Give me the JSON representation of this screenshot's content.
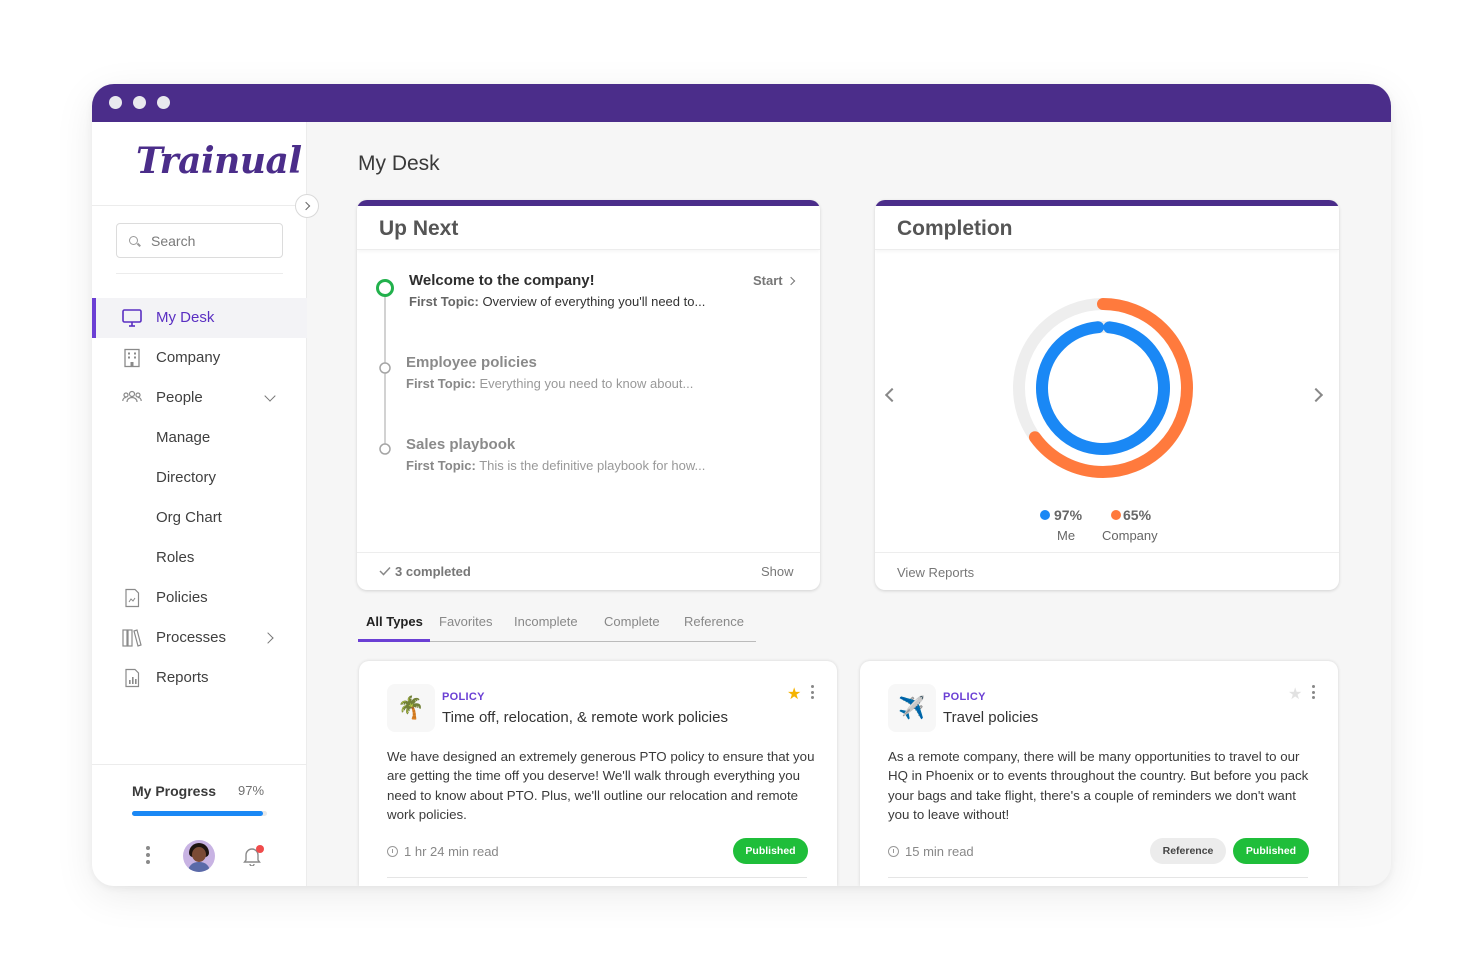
{
  "app": {
    "logo_text": "Trainual",
    "brand_color": "#4b2d8a",
    "accent_color": "#6b3fd4"
  },
  "sidebar": {
    "search_placeholder": "Search",
    "items": [
      {
        "label": "My Desk",
        "icon": "monitor-icon",
        "active": true
      },
      {
        "label": "Company",
        "icon": "building-icon"
      },
      {
        "label": "People",
        "icon": "people-icon",
        "expanded": true
      },
      {
        "label": "Manage"
      },
      {
        "label": "Directory"
      },
      {
        "label": "Org Chart"
      },
      {
        "label": "Roles"
      },
      {
        "label": "Policies",
        "icon": "document-icon"
      },
      {
        "label": "Processes",
        "icon": "books-icon"
      },
      {
        "label": "Reports",
        "icon": "report-icon"
      }
    ],
    "progress": {
      "label": "My Progress",
      "value_text": "97%",
      "value": 0.97
    }
  },
  "main": {
    "page_title": "My Desk",
    "up_next": {
      "title": "Up Next",
      "items": [
        {
          "title": "Welcome to the company!",
          "topic_label": "First Topic:",
          "topic": "Overview of everything you'll need to...",
          "action": "Start"
        },
        {
          "title": "Employee policies",
          "topic_label": "First Topic:",
          "topic": "Everything you need to know about..."
        },
        {
          "title": "Sales playbook",
          "topic_label": "First Topic:",
          "topic": "This is the definitive playbook for how..."
        }
      ],
      "completed_text": "3 completed",
      "show_label": "Show"
    },
    "completion": {
      "title": "Completion",
      "me": {
        "value_text": "97%",
        "label": "Me",
        "value": 0.97,
        "color": "#1a88f5"
      },
      "company": {
        "value_text": "65%",
        "label": "Company",
        "value": 0.65,
        "color": "#ff7a3d"
      },
      "footer_link": "View Reports"
    },
    "tabs": [
      "All Types",
      "Favorites",
      "Incomplete",
      "Complete",
      "Reference"
    ],
    "documents": [
      {
        "type": "POLICY",
        "title": "Time off, relocation, & remote work policies",
        "icon": "palm-tree-icon",
        "body": "We have designed an extremely generous PTO policy to ensure that you are getting the time off you deserve! We'll walk through everything you need to know about PTO. Plus, we'll outline our relocation and remote work policies.",
        "read_time": "1 hr 24 min read",
        "badges": [
          "Published"
        ],
        "favorited": true
      },
      {
        "type": "POLICY",
        "title": "Travel policies",
        "icon": "airplane-icon",
        "body": "As a remote company, there will be many opportunities to travel to our HQ in Phoenix or to events throughout the country. But before you pack your bags and take flight, there's a couple of reminders we don't want you to leave without!",
        "read_time": "15 min read",
        "badges": [
          "Reference",
          "Published"
        ],
        "favorited": false
      }
    ]
  }
}
